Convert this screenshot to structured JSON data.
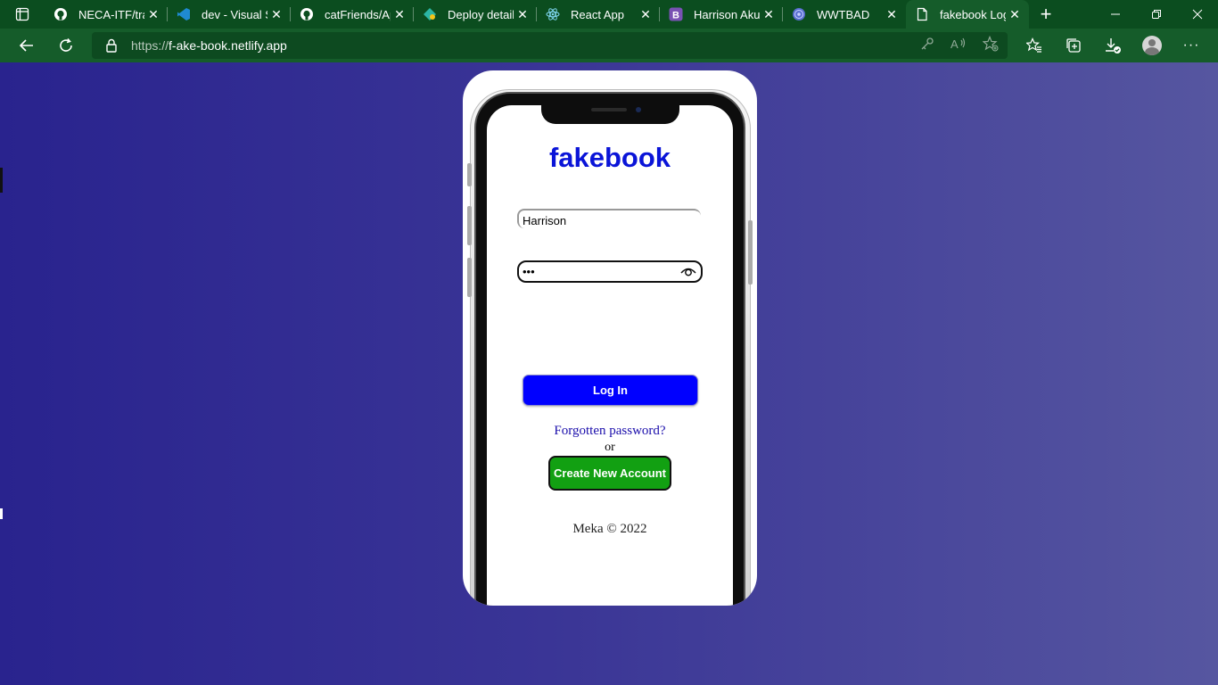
{
  "tabs": [
    {
      "title": "NECA-ITF/trai",
      "icon": "github-icon",
      "active": false
    },
    {
      "title": "dev - Visual S",
      "icon": "vscode-icon",
      "active": false
    },
    {
      "title": "catFriends/Ap",
      "icon": "github-icon",
      "active": false
    },
    {
      "title": "Deploy detail",
      "icon": "netlify-icon",
      "active": false
    },
    {
      "title": "React App",
      "icon": "react-icon",
      "active": false
    },
    {
      "title": "Harrison Akun",
      "icon": "bootstrap-icon",
      "active": false
    },
    {
      "title": "WWTBAD",
      "icon": "globe-icon",
      "active": false
    },
    {
      "title": "fakebook Log",
      "icon": "page-icon",
      "active": true
    }
  ],
  "address_bar": {
    "scheme": "https://",
    "host": "f-ake-book.netlify.app"
  },
  "page": {
    "brand": "fakebook",
    "username_value": "Harrison",
    "password_value": "abc",
    "login_label": "Log In",
    "forgot_label": "Forgotten password?",
    "or_label": "or",
    "create_label": "Create New Account",
    "footer": "Meka © 2022"
  },
  "colors": {
    "chrome_bg": "#155c2a",
    "tabbar_bg": "#0b4d1f",
    "brand": "#0a14d8",
    "login_button": "#0000ff",
    "create_button": "#12a012",
    "link": "#1a0dab"
  }
}
